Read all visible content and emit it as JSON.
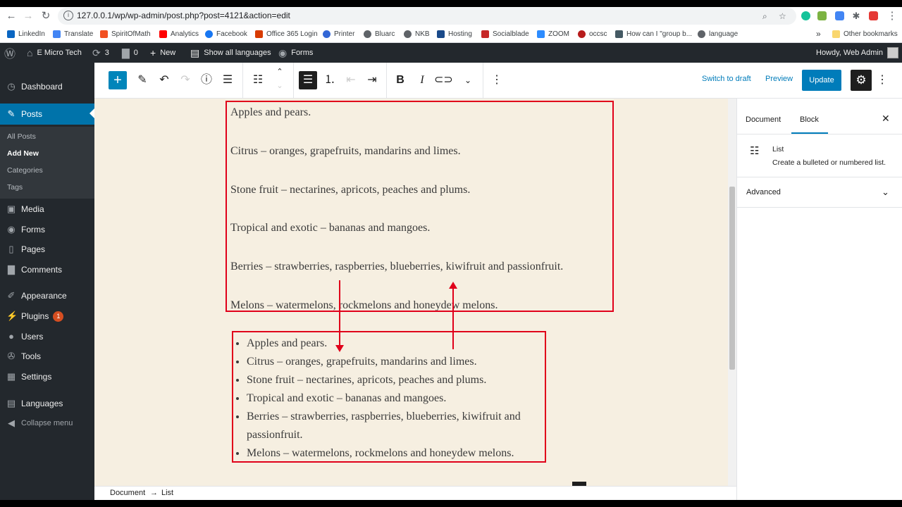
{
  "browser": {
    "url": "127.0.0.1/wp/wp-admin/post.php?post=4121&action=edit",
    "bookmarks": [
      "LinkedIn",
      "Translate",
      "SpiritOfMath",
      "Analytics",
      "Facebook",
      "Office 365 Login",
      "Printer",
      "Bluarc",
      "NKB",
      "Hosting",
      "Socialblade",
      "ZOOM",
      "occsc",
      "How can I \"group b...",
      "language"
    ],
    "other_bookmarks": "Other bookmarks",
    "overflow": "»"
  },
  "adminbar": {
    "site": "E Micro Tech",
    "updates": "3",
    "comments": "0",
    "new": "New",
    "languages": "Show all languages",
    "forms": "Forms",
    "howdy": "Howdy, Web Admin"
  },
  "sidebar": {
    "items": [
      "Dashboard",
      "Posts",
      "Media",
      "Forms",
      "Pages",
      "Comments",
      "Appearance",
      "Plugins",
      "Users",
      "Tools",
      "Settings",
      "Languages",
      "Collapse menu"
    ],
    "submenu": [
      "All Posts",
      "Add New",
      "Categories",
      "Tags"
    ],
    "plugins_badge": "1"
  },
  "toolbar": {
    "switch_draft": "Switch to draft",
    "preview": "Preview",
    "update": "Update"
  },
  "content": {
    "paragraphs": [
      "Apples and pears.",
      "Citrus – oranges, grapefruits, mandarins and limes.",
      "Stone fruit – nectarines, apricots, peaches and plums.",
      "Tropical and exotic – bananas and mangoes.",
      "Berries – strawberries, raspberries, blueberries, kiwifruit and passionfruit.",
      "Melons – watermelons, rockmelons and honeydew melons."
    ],
    "list": [
      "Apples and pears.",
      "Citrus – oranges, grapefruits, mandarins and limes.",
      "Stone fruit – nectarines, apricots, peaches and plums.",
      "Tropical and exotic – bananas and mangoes.",
      "Berries – strawberries, raspberries, blueberries, kiwifruit and passionfruit.",
      "Melons – watermelons, rockmelons and honeydew melons."
    ]
  },
  "panel": {
    "tab_document": "Document",
    "tab_block": "Block",
    "block_name": "List",
    "block_desc": "Create a bulleted or numbered list.",
    "advanced": "Advanced"
  },
  "footer": {
    "breadcrumb_doc": "Document",
    "breadcrumb_arrow": "→",
    "breadcrumb_block": "List"
  },
  "colors": {
    "wp_blue": "#0073aa",
    "annotation_red": "#e0001a",
    "canvas_bg": "#f6efe1"
  }
}
